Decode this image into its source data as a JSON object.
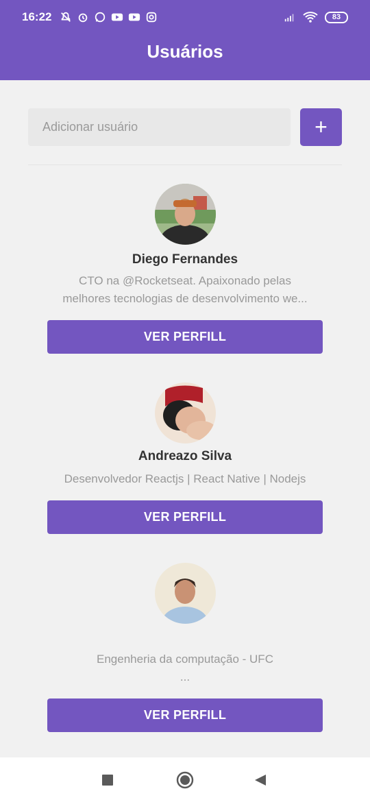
{
  "status_bar": {
    "time": "16:22",
    "battery": "83",
    "icons": [
      "notifications-off-icon",
      "alarm-icon",
      "whatsapp-icon",
      "youtube-icon",
      "youtube-icon",
      "instagram-icon",
      "signal-icon",
      "wifi-icon",
      "battery-icon"
    ]
  },
  "header": {
    "title": "Usuários"
  },
  "search": {
    "placeholder": "Adicionar usuário",
    "value": "",
    "add_label": "+"
  },
  "users": [
    {
      "name": "Diego Fernandes",
      "bio_line1": "CTO na @Rocketseat. Apaixonado pelas",
      "bio_line2": "melhores tecnologias de desenvolvimento we...",
      "button": "VER PERFILL"
    },
    {
      "name": "Andreazo Silva",
      "bio_line1": "Desenvolvedor Reactjs | React Native | Nodejs",
      "button": "VER PERFILL"
    },
    {
      "name": "",
      "bio_line1": "Engenheria da computação - UFC",
      "bio_line2": "...",
      "button": "VER PERFILL"
    }
  ],
  "colors": {
    "primary": "#7356c0",
    "background": "#f1f1f1",
    "input": "#e8e8e8"
  },
  "navbar": {
    "icons": [
      "recents-icon",
      "home-icon",
      "back-icon"
    ]
  }
}
